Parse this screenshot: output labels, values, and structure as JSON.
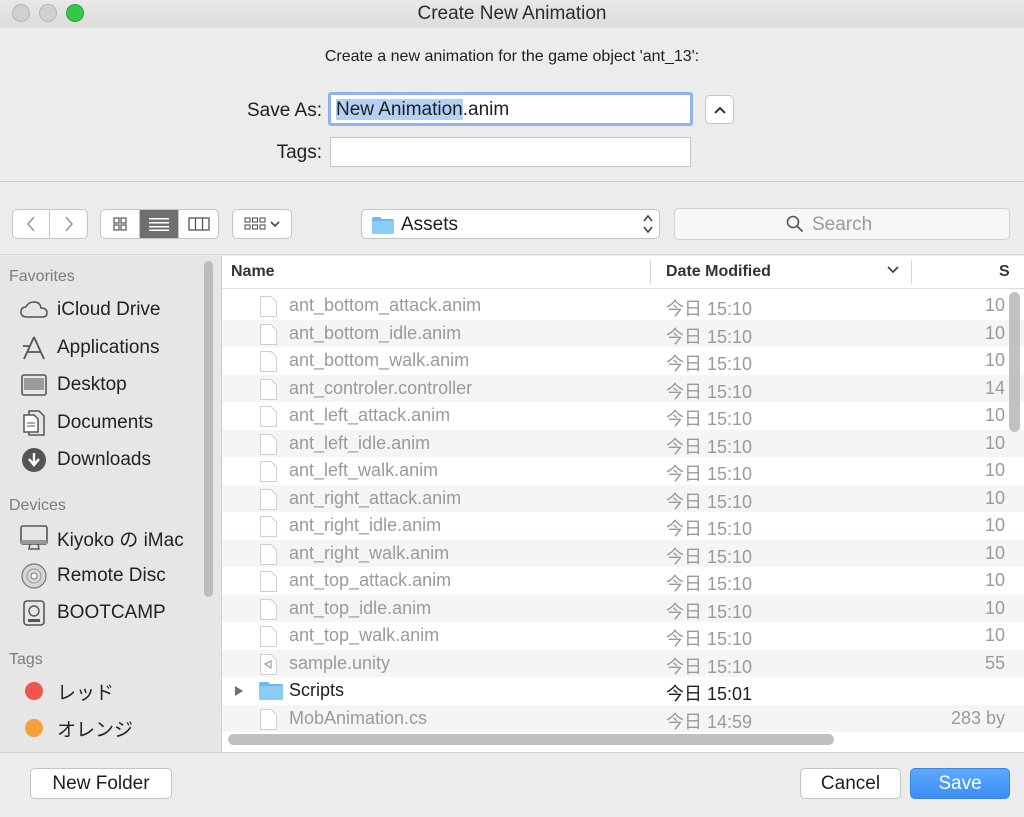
{
  "window": {
    "title": "Create New Animation"
  },
  "dialog": {
    "prompt": "Create a new animation for the game object 'ant_13':",
    "save_as_label": "Save As:",
    "filename_selected": "New Animation",
    "filename_ext": ".anim",
    "tags_label": "Tags:",
    "tags_value": ""
  },
  "toolbar": {
    "location": "Assets",
    "search_placeholder": "Search"
  },
  "sidebar": {
    "favorites_header": "Favorites",
    "favorites": [
      {
        "label": "iCloud Drive",
        "icon": "cloud-icon"
      },
      {
        "label": "Applications",
        "icon": "applications-icon"
      },
      {
        "label": "Desktop",
        "icon": "desktop-icon"
      },
      {
        "label": "Documents",
        "icon": "document-icon"
      },
      {
        "label": "Downloads",
        "icon": "download-icon"
      }
    ],
    "devices_header": "Devices",
    "devices": [
      {
        "label": "Kiyoko の iMac",
        "icon": "imac-icon"
      },
      {
        "label": "Remote Disc",
        "icon": "disc-icon"
      },
      {
        "label": "BOOTCAMP",
        "icon": "drive-icon"
      }
    ],
    "tags_header": "Tags",
    "tags": [
      {
        "label": "レッド",
        "color": "#f0564d"
      },
      {
        "label": "オレンジ",
        "color": "#f5a03b"
      }
    ]
  },
  "file_list": {
    "columns": {
      "name": "Name",
      "date": "Date Modified",
      "size": "S"
    },
    "rows": [
      {
        "name": "ant_bottom_attack.anim",
        "date": "今日 15:10",
        "size": "10",
        "enabled": false
      },
      {
        "name": "ant_bottom_idle.anim",
        "date": "今日 15:10",
        "size": "10",
        "enabled": false
      },
      {
        "name": "ant_bottom_walk.anim",
        "date": "今日 15:10",
        "size": "10",
        "enabled": false
      },
      {
        "name": "ant_controler.controller",
        "date": "今日 15:10",
        "size": "14",
        "enabled": false
      },
      {
        "name": "ant_left_attack.anim",
        "date": "今日 15:10",
        "size": "10",
        "enabled": false
      },
      {
        "name": "ant_left_idle.anim",
        "date": "今日 15:10",
        "size": "10",
        "enabled": false
      },
      {
        "name": "ant_left_walk.anim",
        "date": "今日 15:10",
        "size": "10",
        "enabled": false
      },
      {
        "name": "ant_right_attack.anim",
        "date": "今日 15:10",
        "size": "10",
        "enabled": false
      },
      {
        "name": "ant_right_idle.anim",
        "date": "今日 15:10",
        "size": "10",
        "enabled": false
      },
      {
        "name": "ant_right_walk.anim",
        "date": "今日 15:10",
        "size": "10",
        "enabled": false
      },
      {
        "name": "ant_top_attack.anim",
        "date": "今日 15:10",
        "size": "10",
        "enabled": false
      },
      {
        "name": "ant_top_idle.anim",
        "date": "今日 15:10",
        "size": "10",
        "enabled": false
      },
      {
        "name": "ant_top_walk.anim",
        "date": "今日 15:10",
        "size": "10",
        "enabled": false
      },
      {
        "name": "sample.unity",
        "date": "今日 15:10",
        "size": "55",
        "enabled": false,
        "icon": "unity-icon"
      },
      {
        "name": "Scripts",
        "date": "今日 15:01",
        "size": "",
        "enabled": true,
        "icon": "folder-icon"
      },
      {
        "name": "MobAnimation.cs",
        "date": "今日 14:59",
        "size": "283 by",
        "enabled": false
      }
    ]
  },
  "buttons": {
    "new_folder": "New Folder",
    "cancel": "Cancel",
    "save": "Save"
  },
  "colors": {
    "accent": "#3b8df6",
    "selection": "#b3d0f5"
  }
}
